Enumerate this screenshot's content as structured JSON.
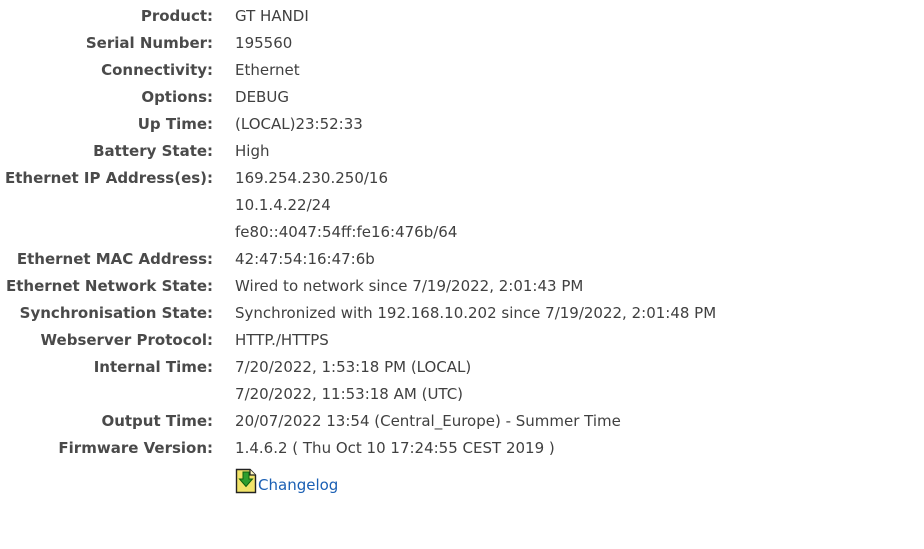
{
  "info_rows": [
    {
      "label": "Product:",
      "values": [
        "GT HANDI"
      ]
    },
    {
      "label": "Serial Number:",
      "values": [
        "195560"
      ]
    },
    {
      "label": "Connectivity:",
      "values": [
        "Ethernet"
      ]
    },
    {
      "label": "Options:",
      "values": [
        "DEBUG"
      ]
    },
    {
      "label": "Up Time:",
      "values": [
        "(LOCAL)23:52:33"
      ]
    },
    {
      "label": "Battery State:",
      "values": [
        "High"
      ]
    },
    {
      "label": "Ethernet IP Address(es):",
      "values": [
        "169.254.230.250/16",
        "10.1.4.22/24",
        "fe80::4047:54ff:fe16:476b/64"
      ]
    },
    {
      "label": "Ethernet MAC Address:",
      "values": [
        "42:47:54:16:47:6b"
      ]
    },
    {
      "label": "Ethernet Network State:",
      "values": [
        "Wired to network since 7/19/2022, 2:01:43 PM"
      ]
    },
    {
      "label": "Synchronisation State:",
      "values": [
        "Synchronized with 192.168.10.202 since 7/19/2022, 2:01:48 PM"
      ]
    },
    {
      "label": "Webserver Protocol:",
      "values": [
        "HTTP./HTTPS"
      ]
    },
    {
      "label": "Internal Time:",
      "values": [
        "7/20/2022, 1:53:18 PM (LOCAL)",
        "7/20/2022, 11:53:18 AM (UTC)"
      ]
    },
    {
      "label": "Output Time:",
      "values": [
        "20/07/2022 13:54 (Central_Europe) - Summer Time"
      ]
    },
    {
      "label": "Firmware Version:",
      "values": [
        "1.4.6.2 ( Thu Oct 10 17:24:55 CEST 2019 )"
      ]
    }
  ],
  "changelog": {
    "label": "Changelog",
    "icon": "download-document-icon"
  },
  "colors": {
    "label_text": "#4a4a4a",
    "value_text": "#404040",
    "link": "#1a5fb4",
    "icon_yellow": "#f2e46a",
    "icon_green": "#2e9e2e"
  }
}
